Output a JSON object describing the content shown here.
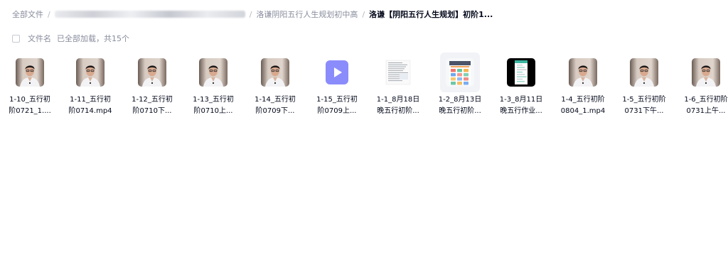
{
  "breadcrumb": {
    "root": "全部文件",
    "parent": "洛谦阴阳五行人生规划初中高",
    "current": "洛谦【阴阳五行人生规划】初阶1..."
  },
  "toolbar": {
    "column_label": "文件名",
    "status": "已全部加载，共15个"
  },
  "files": [
    {
      "line1": "1-10_五行初",
      "line2": "阶0721_1....",
      "type": "video-thumbnail"
    },
    {
      "line1": "1-11_五行初",
      "line2": "阶0714.mp4",
      "type": "video-thumbnail"
    },
    {
      "line1": "1-12_五行初",
      "line2": "阶0710下...",
      "type": "video-thumbnail"
    },
    {
      "line1": "1-13_五行初",
      "line2": "阶0710上...",
      "type": "video-thumbnail"
    },
    {
      "line1": "1-14_五行初",
      "line2": "阶0709下...",
      "type": "video-thumbnail"
    },
    {
      "line1": "1-15_五行初",
      "line2": "阶0709上...",
      "type": "video-file-icon"
    },
    {
      "line1": "1-1_8月18日",
      "line2": "晚五行初阶...",
      "type": "document-thumbnail"
    },
    {
      "line1": "1-2_8月13日",
      "line2": "晚五行初阶...",
      "type": "app-screenshot-thumbnail"
    },
    {
      "line1": "1-3_8月11日",
      "line2": "晚五行作业...",
      "type": "phone-screenshot-thumbnail"
    },
    {
      "line1": "1-4_五行初阶",
      "line2": "0804_1.mp4",
      "type": "video-thumbnail"
    },
    {
      "line1": "1-5_五行初阶",
      "line2": "0731下午...",
      "type": "video-thumbnail"
    },
    {
      "line1": "1-6_五行初阶",
      "line2": "0731上午...",
      "type": "video-thumbnail"
    }
  ],
  "colors": {
    "accent_icon": "#8b8cfb",
    "text_primary": "#03081a",
    "text_secondary": "#878c9c"
  }
}
